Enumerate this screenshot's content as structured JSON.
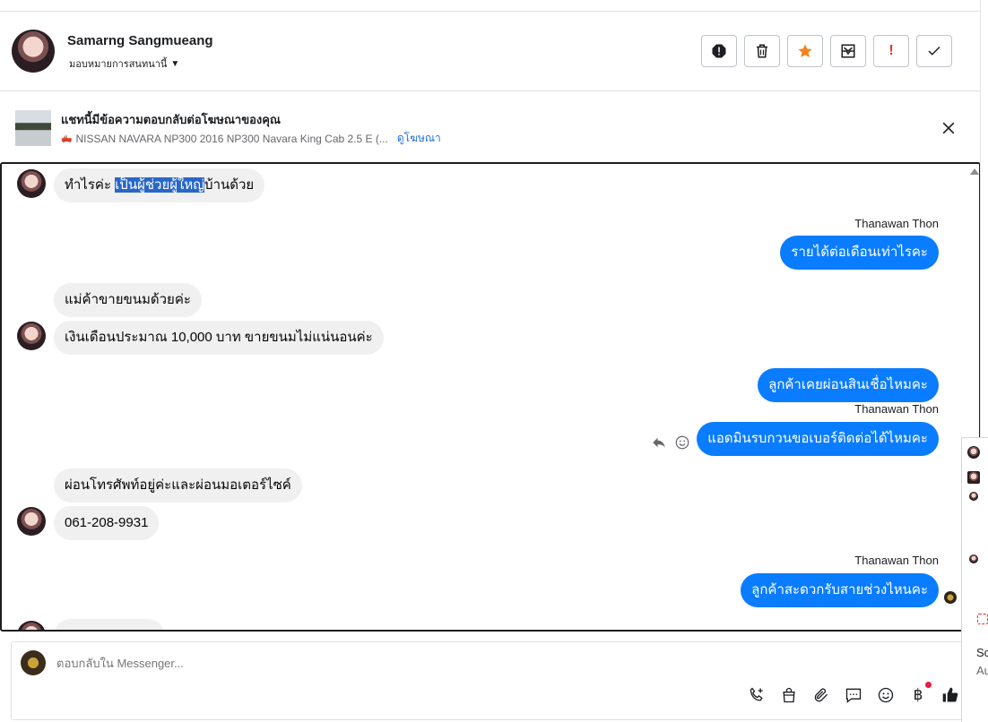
{
  "header": {
    "contact_name": "Samarng Sangmueang",
    "assign_label": "มอบหมายการสนทนานี้",
    "tools": [
      {
        "name": "spam-icon"
      },
      {
        "name": "trash-icon"
      },
      {
        "name": "star-icon"
      },
      {
        "name": "mark-unread-icon"
      },
      {
        "name": "follow-up-icon",
        "label": "!"
      },
      {
        "name": "done-icon"
      }
    ]
  },
  "ad": {
    "title": "แชทนี้มีข้อความตอบกลับต่อโฆษณาของคุณ",
    "subtitle": "NISSAN NAVARA NP300 2016 NP300 Navara King Cab 2.5 E (...",
    "link": "ดูโฆษณา"
  },
  "messages": {
    "m1": {
      "pre": "ทำไรค่ะ ",
      "highlight": "เป็นผู้ช่วยผู้ใหญ่",
      "post": "บ้านด้วย"
    },
    "sender1": "Thanawan Thon",
    "m2": "รายได้ต่อเดือนเท่าไรคะ",
    "m3": "แม่ค้าขายขนมด้วยค่ะ",
    "m4": "เงินเดือนประมาณ 10,000 บาท ขายขนมไม่แน่นอนค่ะ",
    "m5": "ลูกค้าเคยผ่อนสินเชื่อไหมคะ",
    "sender2": "Thanawan Thon",
    "m6": "แอดมินรบกวนขอเบอร์ติดต่อได้ไหมคะ",
    "m7": "ผ่อนโทรศัพท์อยู่ค่ะและผ่อนมอเตอร์ไซค์",
    "m8": "061-208-9931",
    "sender3": "Thanawan Thon",
    "m9": "ลูกค้าสะดวกรับสายช่วงไหนคะ"
  },
  "composer": {
    "placeholder": "ตอบกลับใน Messenger...",
    "baht_symbol": "฿"
  },
  "side_panel": {
    "text1": "Sc",
    "text2": "Au"
  },
  "colors": {
    "outgoing_bubble": "#0a7cff",
    "incoming_bubble": "#f0f0f0",
    "link": "#216fdb",
    "star": "#f5821f",
    "selection": "#2867c9"
  }
}
